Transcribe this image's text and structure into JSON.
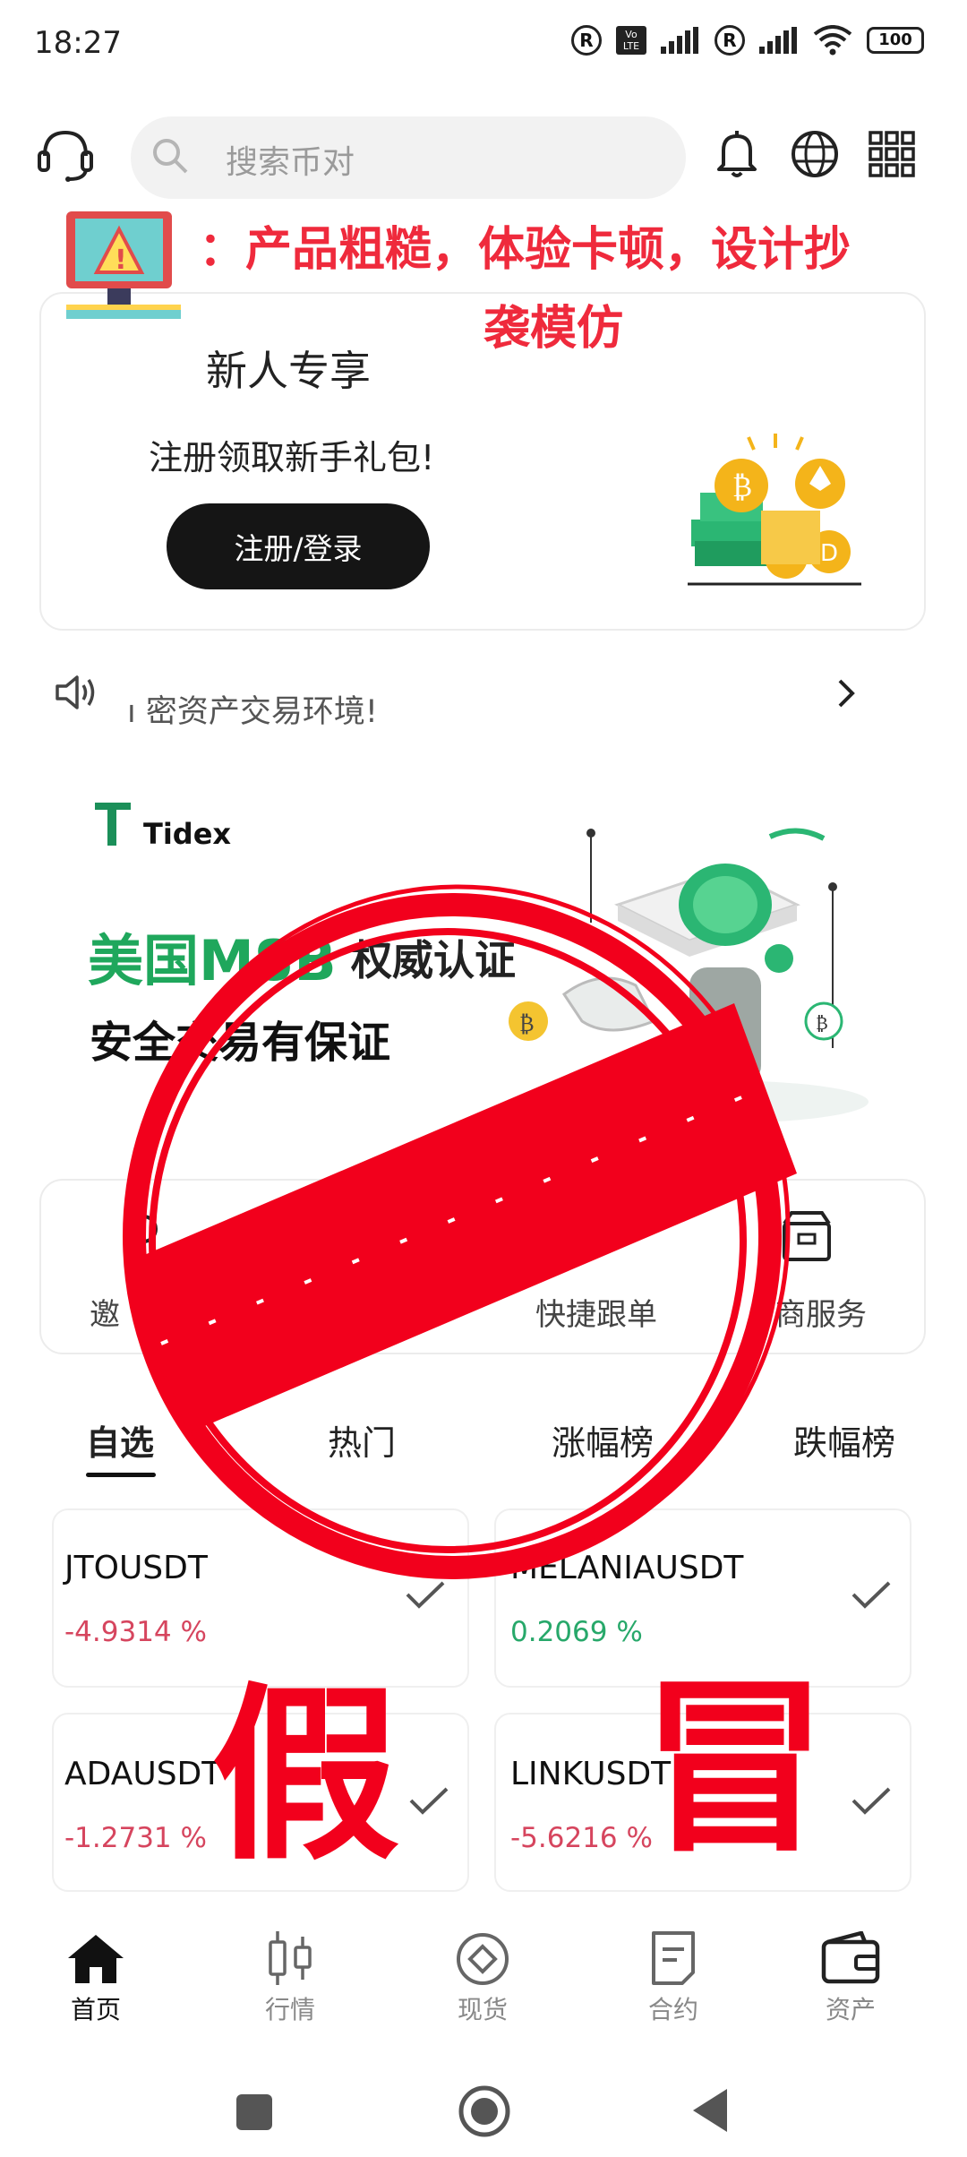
{
  "status_bar": {
    "time": "18:27",
    "battery": "100",
    "volte_label": "Vo LTE",
    "reg_symbol": "R"
  },
  "header": {
    "search_placeholder": "搜索币对"
  },
  "warning": {
    "line1": "：产品粗糙，体验卡顿，设计抄",
    "line2": "袭模仿"
  },
  "new_user_card": {
    "title": "新人专享",
    "subtitle": "注册领取新手礼包!",
    "button_label": "注册/登录"
  },
  "announcement": {
    "text": "ı 密资产交易环境!"
  },
  "banner": {
    "brand": "Tidex",
    "line1": "美国MSB",
    "line1_suffix": "权威认证",
    "line2": "安全交易有保证"
  },
  "quick_menu": {
    "items": [
      {
        "label": "邀"
      },
      {
        "label": "快捷跟单"
      },
      {
        "label": "商服务"
      }
    ]
  },
  "market_tabs": [
    "自选",
    "热门",
    "涨幅榜",
    "跌幅榜"
  ],
  "pairs": [
    {
      "symbol": "JTOUSDT",
      "change": "-4.9314 %"
    },
    {
      "symbol": "MELANIAUSDT",
      "change": "0.2069 %"
    },
    {
      "symbol": "ADAUSDT",
      "change": "-1.2731 %"
    },
    {
      "symbol": "LINKUSDT",
      "change": "-5.6216 %"
    }
  ],
  "stamp": {
    "char_left": "假",
    "char_right": "冒"
  },
  "bottom_nav": [
    {
      "label": "首页",
      "icon": "home-icon"
    },
    {
      "label": "行情",
      "icon": "candlestick-icon"
    },
    {
      "label": "现货",
      "icon": "spot-icon"
    },
    {
      "label": "合约",
      "icon": "contract-icon"
    },
    {
      "label": "资产",
      "icon": "wallet-icon"
    }
  ],
  "colors": {
    "stamp_red": "#f2001c",
    "warning_red": "#ef2a3c",
    "brand_green": "#1fa75c",
    "negative": "#d6455e",
    "positive": "#27a86a"
  }
}
